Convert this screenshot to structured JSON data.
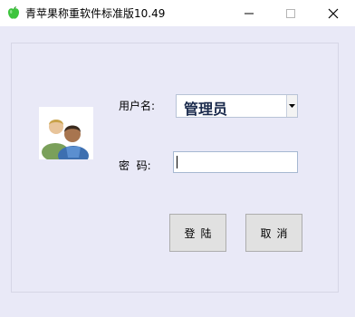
{
  "window": {
    "title": "青苹果称重软件标准版10.49",
    "icon": "green-apple-icon",
    "controls": [
      "minimize-icon",
      "maximize-icon",
      "close-icon"
    ]
  },
  "form": {
    "username_label": "用户名:",
    "username_value": "管理员",
    "password_label": "密  码:",
    "password_value": ""
  },
  "buttons": {
    "login_label": "登陆",
    "cancel_label": "取消"
  },
  "colors": {
    "client_background": "#e9e9f7",
    "apple_green": "#3cc43c",
    "button_face": "#e1e1e1"
  }
}
